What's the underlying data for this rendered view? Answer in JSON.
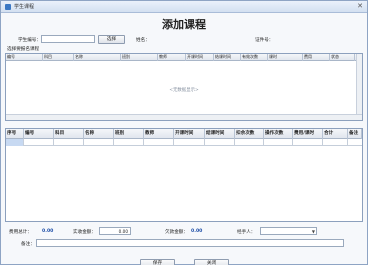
{
  "window": {
    "title": "学生课程"
  },
  "heading": "添加课程",
  "student": {
    "id_label": "学生编号：",
    "id_value": "",
    "select_button": "选择",
    "name_label": "姓名：",
    "doc_label": "证件号："
  },
  "course_section_label": "选择要报名课程",
  "course_grid": {
    "columns": [
      "编号",
      "科目",
      "名称",
      "班别",
      "教师",
      "开课时间",
      "结课时间",
      "有效次数",
      "课时",
      "费用",
      "状态",
      "备注"
    ],
    "empty_text": "<无数据显示>"
  },
  "enroll_grid": {
    "columns": [
      "序号",
      "编号",
      "科目",
      "名称",
      "班别",
      "教师",
      "开课时间",
      "结课时间",
      "扣余次数",
      "操作次数",
      "费用/课时",
      "合计",
      "备注"
    ]
  },
  "summary": {
    "total_label": "费用总计：",
    "total_value": "0.00",
    "paid_label": "实收金额：",
    "paid_value": "0.00",
    "owed_label": "欠款金额：",
    "owed_value": "0.00",
    "handler_label": "经手人：",
    "handler_value": "",
    "note_label": "备注：",
    "note_value": ""
  },
  "buttons": {
    "save": "保存",
    "close": "关闭"
  }
}
